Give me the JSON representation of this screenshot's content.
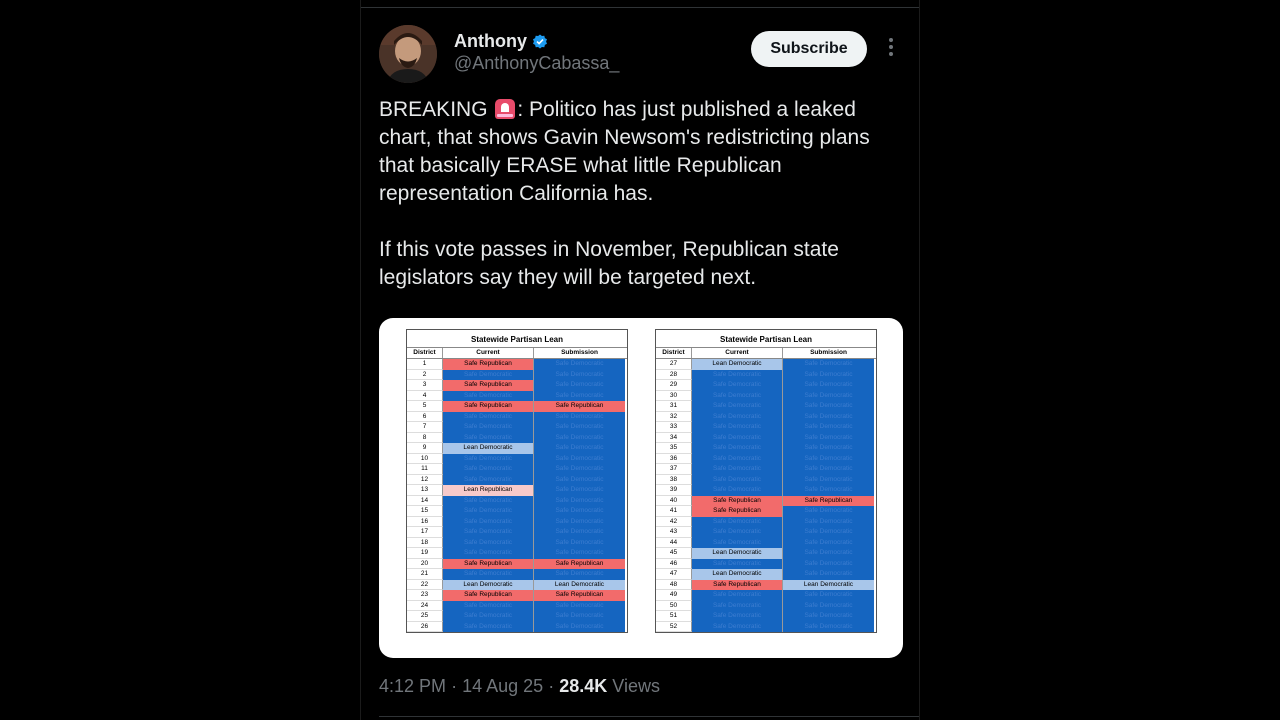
{
  "author": {
    "name": "Anthony",
    "handle": "@AnthonyCabassa_",
    "verified_color": "#1d9bf0"
  },
  "actions": {
    "subscribe_label": "Subscribe",
    "more_icon": "more-vertical-icon"
  },
  "tweet": {
    "p1_before": "BREAKING ",
    "p1_emoji": "siren-emoji",
    "p1_after": ": Politico has just published a leaked chart, that shows Gavin Newsom's redistricting plans that basically ERASE what little Republican representation California has.",
    "p2": "If this vote passes in November, Republican state legislators say they will be targeted next."
  },
  "meta": {
    "time": "4:12 PM",
    "date": "14 Aug 25",
    "views_count": "28.4K",
    "views_label": "Views",
    "sep": "·"
  },
  "colors": {
    "safe_democratic": "#1565c0",
    "lean_democratic": "#a8c6ea",
    "safe_republican": "#f26b6b",
    "lean_republican": "#f7caca"
  },
  "chart_data": {
    "type": "table",
    "tables": [
      {
        "title": "Statewide Partisan Lean",
        "columns": [
          "District",
          "Current",
          "Submission"
        ],
        "rows": [
          [
            "1",
            "Safe Republican",
            "Safe Democratic"
          ],
          [
            "2",
            "Safe Democratic",
            "Safe Democratic"
          ],
          [
            "3",
            "Safe Republican",
            "Safe Democratic"
          ],
          [
            "4",
            "Safe Democratic",
            "Safe Democratic"
          ],
          [
            "5",
            "Safe Republican",
            "Safe Republican"
          ],
          [
            "6",
            "Safe Democratic",
            "Safe Democratic"
          ],
          [
            "7",
            "Safe Democratic",
            "Safe Democratic"
          ],
          [
            "8",
            "Safe Democratic",
            "Safe Democratic"
          ],
          [
            "9",
            "Lean Democratic",
            "Safe Democratic"
          ],
          [
            "10",
            "Safe Democratic",
            "Safe Democratic"
          ],
          [
            "11",
            "Safe Democratic",
            "Safe Democratic"
          ],
          [
            "12",
            "Safe Democratic",
            "Safe Democratic"
          ],
          [
            "13",
            "Lean Republican",
            "Safe Democratic"
          ],
          [
            "14",
            "Safe Democratic",
            "Safe Democratic"
          ],
          [
            "15",
            "Safe Democratic",
            "Safe Democratic"
          ],
          [
            "16",
            "Safe Democratic",
            "Safe Democratic"
          ],
          [
            "17",
            "Safe Democratic",
            "Safe Democratic"
          ],
          [
            "18",
            "Safe Democratic",
            "Safe Democratic"
          ],
          [
            "19",
            "Safe Democratic",
            "Safe Democratic"
          ],
          [
            "20",
            "Safe Republican",
            "Safe Republican"
          ],
          [
            "21",
            "Safe Democratic",
            "Safe Democratic"
          ],
          [
            "22",
            "Lean Democratic",
            "Lean Democratic"
          ],
          [
            "23",
            "Safe Republican",
            "Safe Republican"
          ],
          [
            "24",
            "Safe Democratic",
            "Safe Democratic"
          ],
          [
            "25",
            "Safe Democratic",
            "Safe Democratic"
          ],
          [
            "26",
            "Safe Democratic",
            "Safe Democratic"
          ]
        ]
      },
      {
        "title": "Statewide Partisan Lean",
        "columns": [
          "District",
          "Current",
          "Submission"
        ],
        "rows": [
          [
            "27",
            "Lean Democratic",
            "Safe Democratic"
          ],
          [
            "28",
            "Safe Democratic",
            "Safe Democratic"
          ],
          [
            "29",
            "Safe Democratic",
            "Safe Democratic"
          ],
          [
            "30",
            "Safe Democratic",
            "Safe Democratic"
          ],
          [
            "31",
            "Safe Democratic",
            "Safe Democratic"
          ],
          [
            "32",
            "Safe Democratic",
            "Safe Democratic"
          ],
          [
            "33",
            "Safe Democratic",
            "Safe Democratic"
          ],
          [
            "34",
            "Safe Democratic",
            "Safe Democratic"
          ],
          [
            "35",
            "Safe Democratic",
            "Safe Democratic"
          ],
          [
            "36",
            "Safe Democratic",
            "Safe Democratic"
          ],
          [
            "37",
            "Safe Democratic",
            "Safe Democratic"
          ],
          [
            "38",
            "Safe Democratic",
            "Safe Democratic"
          ],
          [
            "39",
            "Safe Democratic",
            "Safe Democratic"
          ],
          [
            "40",
            "Safe Republican",
            "Safe Republican"
          ],
          [
            "41",
            "Safe Republican",
            "Safe Democratic"
          ],
          [
            "42",
            "Safe Democratic",
            "Safe Democratic"
          ],
          [
            "43",
            "Safe Democratic",
            "Safe Democratic"
          ],
          [
            "44",
            "Safe Democratic",
            "Safe Democratic"
          ],
          [
            "45",
            "Lean Democratic",
            "Safe Democratic"
          ],
          [
            "46",
            "Safe Democratic",
            "Safe Democratic"
          ],
          [
            "47",
            "Lean Democratic",
            "Safe Democratic"
          ],
          [
            "48",
            "Safe Republican",
            "Lean Democratic"
          ],
          [
            "49",
            "Safe Democratic",
            "Safe Democratic"
          ],
          [
            "50",
            "Safe Democratic",
            "Safe Democratic"
          ],
          [
            "51",
            "Safe Democratic",
            "Safe Democratic"
          ],
          [
            "52",
            "Safe Democratic",
            "Safe Democratic"
          ]
        ]
      }
    ]
  }
}
